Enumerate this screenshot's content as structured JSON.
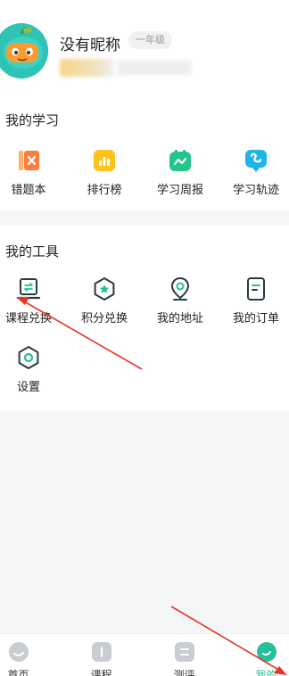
{
  "profile": {
    "nickname": "没有昵称",
    "grade": "一年级"
  },
  "study": {
    "title": "我的学习",
    "items": [
      {
        "label": "错题本",
        "icon": "wrong-book-icon",
        "color": "#ff7a3d"
      },
      {
        "label": "排行榜",
        "icon": "ranking-icon",
        "color": "#ffc21a"
      },
      {
        "label": "学习周报",
        "icon": "weekly-report-icon",
        "color": "#22c58a"
      },
      {
        "label": "学习轨迹",
        "icon": "learning-track-icon",
        "color": "#1fb5e8"
      }
    ]
  },
  "tools": {
    "title": "我的工具",
    "items": [
      {
        "label": "课程兑换",
        "icon": "course-exchange-icon"
      },
      {
        "label": "积分兑换",
        "icon": "points-exchange-icon"
      },
      {
        "label": "我的地址",
        "icon": "address-icon"
      },
      {
        "label": "我的订单",
        "icon": "orders-icon"
      },
      {
        "label": "设置",
        "icon": "settings-icon"
      }
    ],
    "icon_color": "#2b3a3f",
    "accent_color": "#25c09a"
  },
  "tabbar": {
    "items": [
      {
        "label": "首页",
        "icon": "home-icon"
      },
      {
        "label": "课程",
        "icon": "course-icon"
      },
      {
        "label": "测评",
        "icon": "assessment-icon"
      },
      {
        "label": "我的",
        "icon": "me-icon"
      }
    ],
    "active_color": "#25c09a",
    "inactive_color": "#c9ccd2"
  },
  "annotation_color": "#e8352a"
}
